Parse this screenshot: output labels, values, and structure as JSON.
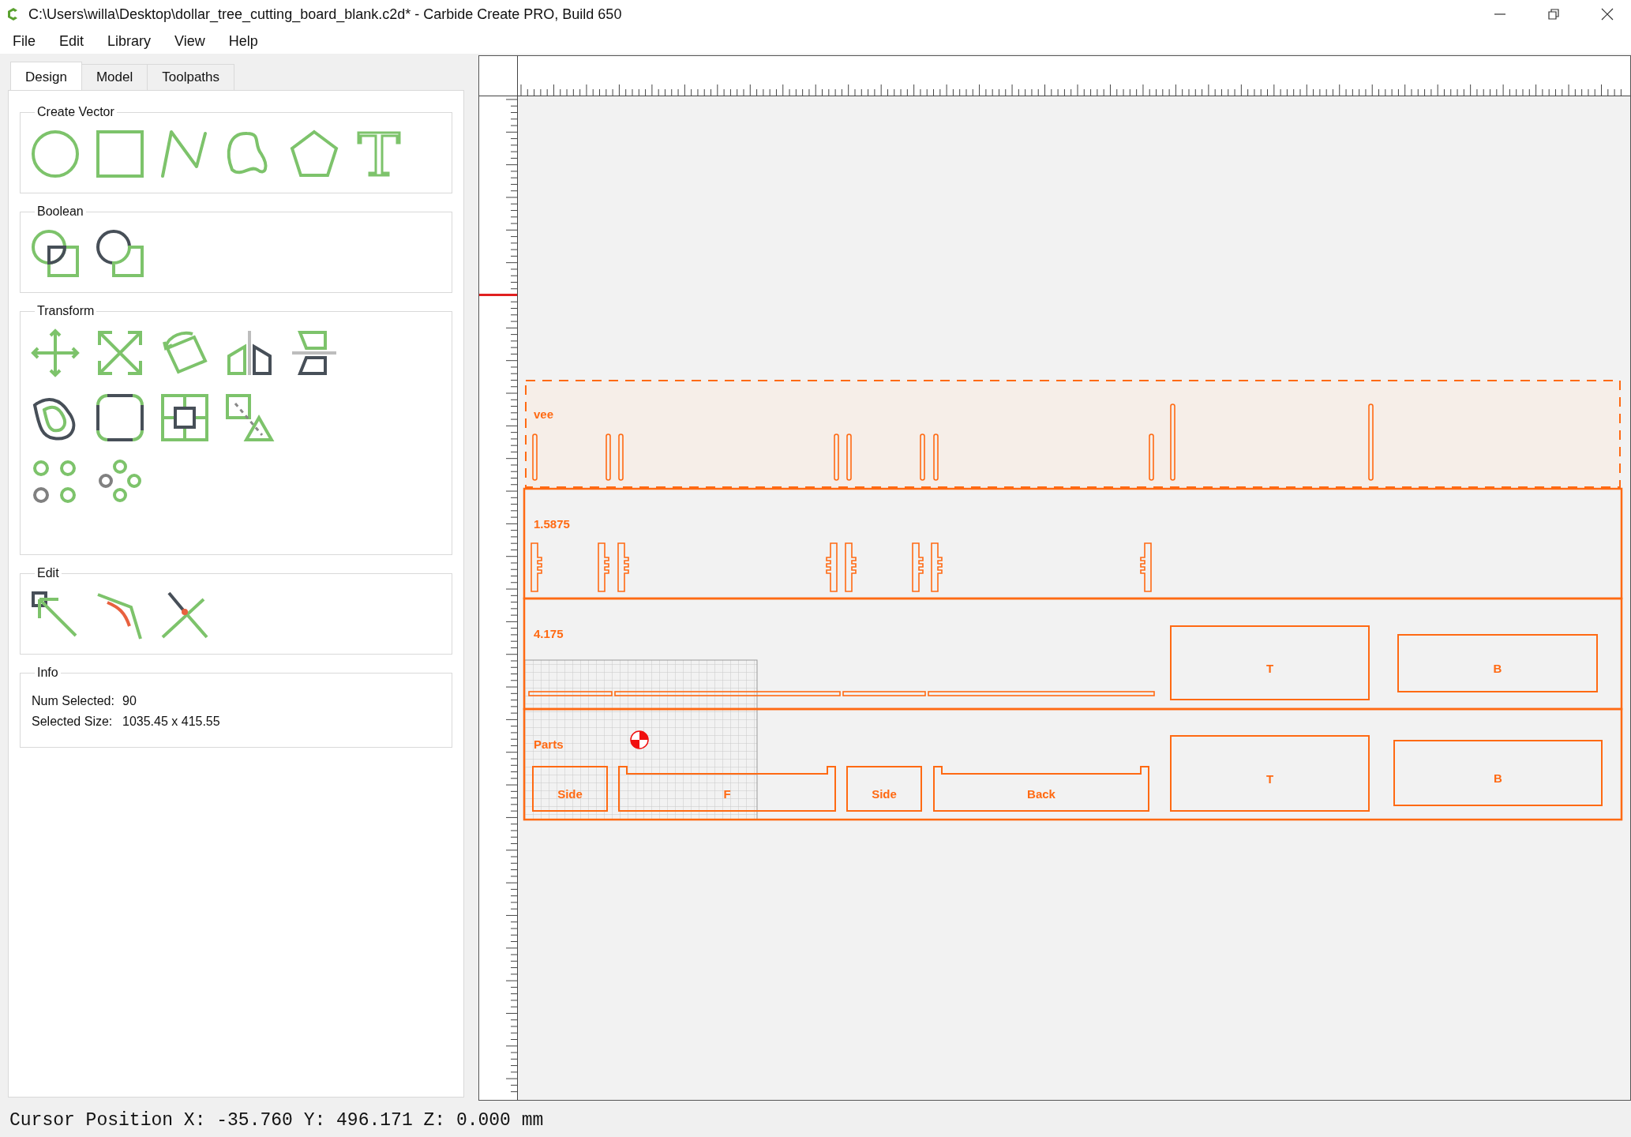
{
  "window": {
    "title": "C:\\Users\\willa\\Desktop\\dollar_tree_cutting_board_blank.c2d* - Carbide Create PRO, Build 650"
  },
  "menu": [
    "File",
    "Edit",
    "Library",
    "View",
    "Help"
  ],
  "tabs": [
    {
      "label": "Design",
      "selected": true
    },
    {
      "label": "Model",
      "selected": false
    },
    {
      "label": "Toolpaths",
      "selected": false
    }
  ],
  "sections": [
    "Create Vector",
    "Boolean",
    "Transform",
    "Edit",
    "Info"
  ],
  "info": [
    {
      "label": "Num Selected:",
      "value": "90"
    },
    {
      "label": "Selected Size:",
      "value": "1035.45 x 415.55"
    }
  ],
  "canvas": {
    "groups": [
      {
        "label": "vee",
        "selected": true
      },
      {
        "label": "1.5875",
        "selected": false
      },
      {
        "label": "4.175",
        "selected": false,
        "parts": [
          "T",
          "B"
        ]
      },
      {
        "label": "Parts",
        "selected": false,
        "parts": [
          "Side",
          "F",
          "Side",
          "Back",
          "T",
          "B"
        ]
      }
    ]
  },
  "status_bar": "Cursor Position X: -35.760 Y: 496.171 Z: 0.000 mm"
}
